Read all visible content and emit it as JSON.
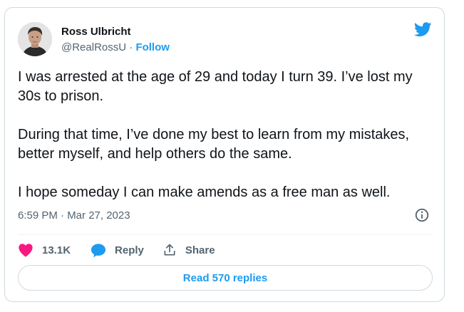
{
  "author": {
    "name": "Ross Ulbricht",
    "handle": "@RealRossU",
    "separator": " · ",
    "follow_label": "Follow"
  },
  "tweet": {
    "paragraphs": [
      "I was arrested at the age of 29 and today I turn 39. I’ve lost my 30s to prison.",
      "During that time, I’ve done my best to learn from my mistakes, better myself, and help others do the same.",
      "I hope someday I can make amends as a free man as well."
    ],
    "timestamp": "6:59 PM · Mar 27, 2023"
  },
  "actions": {
    "like_count": "13.1K",
    "reply_label": "Reply",
    "share_label": "Share"
  },
  "replies": {
    "button_label": "Read 570 replies"
  },
  "icons": {
    "brand": "twitter-bird-icon",
    "info": "info-icon",
    "like": "heart-icon",
    "reply": "speech-bubble-icon",
    "share": "share-arrow-icon"
  },
  "colors": {
    "brand_blue": "#1d9bf0",
    "like_pink": "#f91880",
    "text_primary": "#0f1419",
    "text_secondary": "#536471",
    "border": "#cfd9de"
  }
}
